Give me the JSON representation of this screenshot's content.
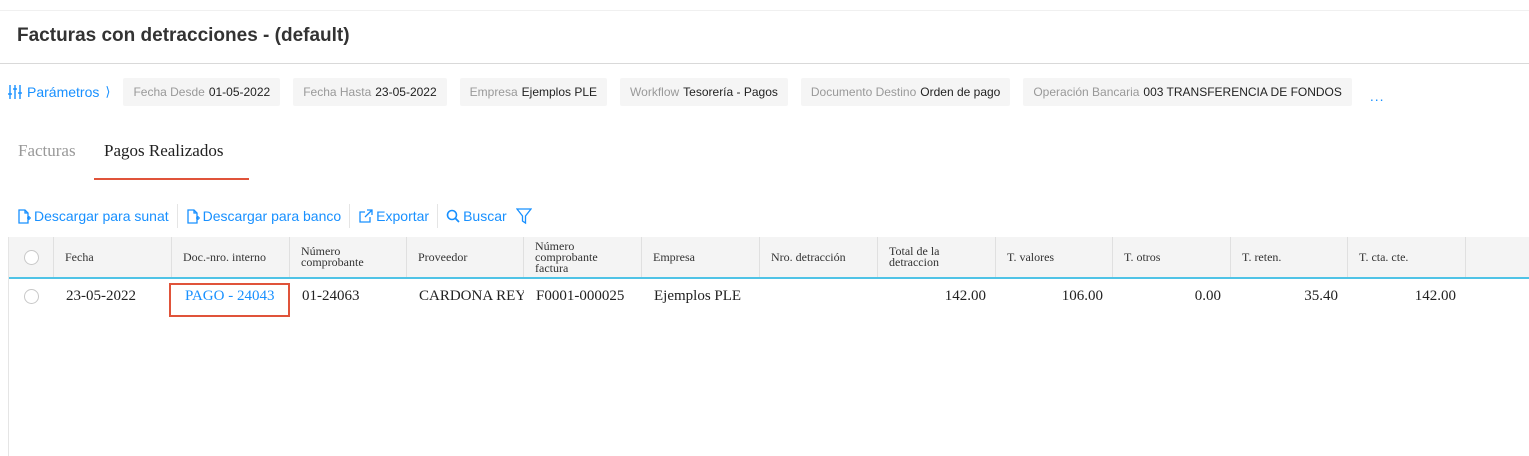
{
  "page": {
    "title": "Facturas con detracciones - (default)"
  },
  "params": {
    "label": "Parámetros",
    "chevron": "⟩",
    "more": "...",
    "chips": [
      {
        "key": "Fecha Desde",
        "value": "01-05-2022"
      },
      {
        "key": "Fecha Hasta",
        "value": "23-05-2022"
      },
      {
        "key": "Empresa",
        "value": "Ejemplos PLE"
      },
      {
        "key": "Workflow",
        "value": "Tesorería - Pagos"
      },
      {
        "key": "Documento Destino",
        "value": "Orden de pago"
      },
      {
        "key": "Operación Bancaria",
        "value": "003 TRANSFERENCIA DE FONDOS"
      }
    ]
  },
  "tabs": [
    {
      "label": "Facturas",
      "active": false
    },
    {
      "label": "Pagos Realizados",
      "active": true
    }
  ],
  "toolbar": {
    "download_sunat": "Descargar para sunat",
    "download_bank": "Descargar para banco",
    "export": "Exportar",
    "search": "Buscar"
  },
  "table": {
    "columns": [
      "Fecha",
      "Doc.-nro. interno",
      "Número comprobante",
      "Proveedor",
      "Número comprobante factura",
      "Empresa",
      "Nro. detracción",
      "Total de la detraccion",
      "T. valores",
      "T. otros",
      "T. reten.",
      "T. cta. cte."
    ],
    "rows": [
      {
        "fecha": "23-05-2022",
        "doc": "PAGO - 24043",
        "comprobante": "01-24063",
        "proveedor": "CARDONA REYES",
        "comprobante_factura": "F0001-000025",
        "empresa": "Ejemplos PLE",
        "nro_detraccion": "",
        "total_detraccion": "142.00",
        "t_valores": "106.00",
        "t_otros": "0.00",
        "t_reten": "35.40",
        "t_cta_cte": "142.00"
      }
    ]
  },
  "colors": {
    "accent": "#1890ff",
    "highlight": "#e0533a",
    "header_border": "#4fc3e6"
  }
}
